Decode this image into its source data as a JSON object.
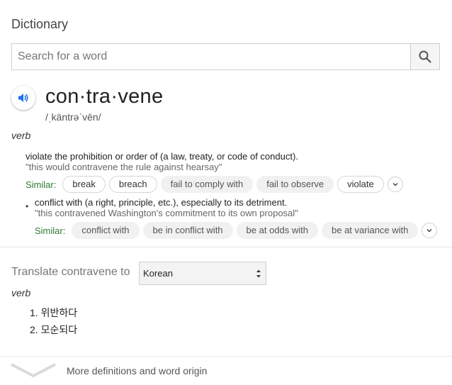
{
  "header": {
    "title": "Dictionary"
  },
  "search": {
    "placeholder": "Search for a word",
    "value": ""
  },
  "entry": {
    "word": "con·tra·vene",
    "phonetic": "/ˌkäntrəˈvēn/",
    "part_of_speech": "verb",
    "senses": [
      {
        "definition": "violate the prohibition or order of (a law, treaty, or code of conduct).",
        "example": "\"this would contravene the rule against hearsay\"",
        "similar_label": "Similar:",
        "similar": [
          "break",
          "breach",
          "fail to comply with",
          "fail to observe",
          "violate"
        ]
      },
      {
        "bullet": "•",
        "definition": "conflict with (a right, principle, etc.), especially to its detriment.",
        "example": "\"this contravened Washington's commitment to its own proposal\"",
        "similar_label": "Similar:",
        "similar": [
          "conflict with",
          "be in conflict with",
          "be at odds with",
          "be at variance with"
        ]
      }
    ]
  },
  "translate": {
    "label": "Translate contravene to",
    "language": "Korean",
    "part_of_speech": "verb",
    "items": [
      "1. 위반하다",
      "2. 모순되다"
    ]
  },
  "footer": {
    "more_label": "More definitions and word origin"
  },
  "colors": {
    "accent": "#1a73e8",
    "similar_green": "#2e7d32"
  }
}
